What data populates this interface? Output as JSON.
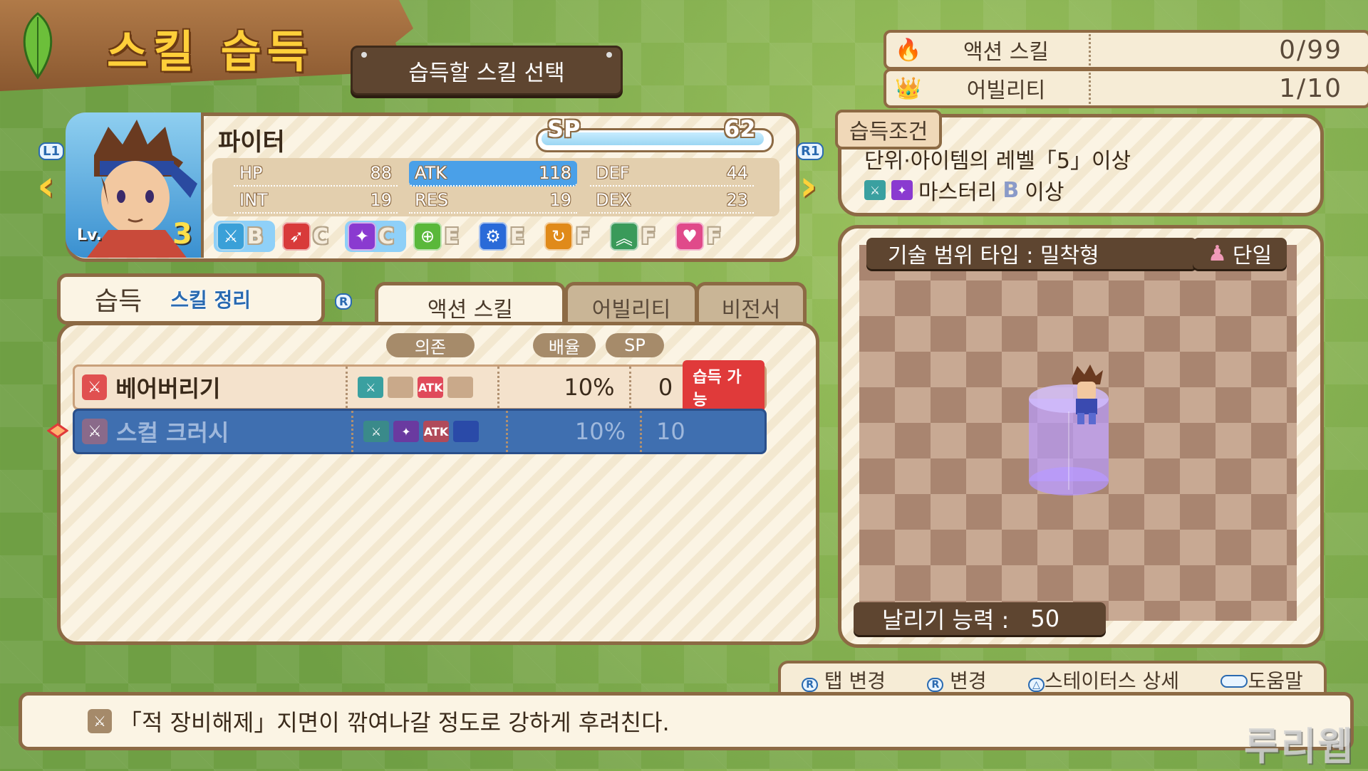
{
  "header": {
    "title": "스킬 습득",
    "subtitle": "습득할 스킬 선택"
  },
  "counters": [
    {
      "icon": "action-skill-icon",
      "label": "액션 스킬",
      "value": "0/99"
    },
    {
      "icon": "ability-icon",
      "label": "어빌리티",
      "value": "1/10"
    }
  ],
  "character": {
    "name": "파이터",
    "level_label": "Lv.",
    "level": "3",
    "sp_label": "SP",
    "sp_value": "62",
    "stats": {
      "hp": {
        "label": "HP",
        "value": "88"
      },
      "atk": {
        "label": "ATK",
        "value": "118"
      },
      "def": {
        "label": "DEF",
        "value": "44"
      },
      "int": {
        "label": "INT",
        "value": "19"
      },
      "res": {
        "label": "RES",
        "value": "19"
      },
      "dex": {
        "label": "DEX",
        "value": "23"
      }
    },
    "weapon_grades": [
      {
        "icon": "sword-icon",
        "color": "#3aa0d8",
        "grade": "B",
        "selected": true
      },
      {
        "icon": "spear-icon",
        "color": "#d83a3a",
        "grade": "C"
      },
      {
        "icon": "axe-icon",
        "color": "#8a3ad0",
        "grade": "C",
        "selected": true
      },
      {
        "icon": "bow-icon",
        "color": "#5ab83a",
        "grade": "E"
      },
      {
        "icon": "gun-icon",
        "color": "#2a6ad8",
        "grade": "E"
      },
      {
        "icon": "fist-icon",
        "color": "#e08a1a",
        "grade": "F"
      },
      {
        "icon": "staff-icon",
        "color": "#3a9a5a",
        "grade": "F"
      },
      {
        "icon": "heart-icon",
        "color": "#e04a8a",
        "grade": "F"
      }
    ],
    "nav_left": "L1",
    "nav_right": "R1"
  },
  "learn": {
    "label": "습득",
    "organize": "스킬 정리",
    "r_hint": "R"
  },
  "tabs": [
    {
      "label": "액션 스킬",
      "active": true
    },
    {
      "label": "어빌리티",
      "active": false
    },
    {
      "label": "비전서",
      "active": false
    }
  ],
  "columns": {
    "deps": "의존",
    "rate": "배율",
    "sp": "SP"
  },
  "skills": [
    {
      "name": "베어버리기",
      "rate": "10%",
      "sp": "0",
      "badge": "습득 가능",
      "deps_atk": "ATK"
    },
    {
      "name": "스컬 크러시",
      "rate": "10%",
      "sp": "10",
      "badge": "",
      "deps_atk": "ATK"
    }
  ],
  "requirements": {
    "tag": "습득조건",
    "line1": "단위·아이템의 레벨「5」이상",
    "line2_text": "마스터리",
    "line2_grade": "B",
    "line2_suffix": "이상"
  },
  "preview": {
    "range_type": "기술 범위 타입 : 밀착형",
    "target": "단일",
    "knockback_label": "날리기 능력 :",
    "knockback_value": "50"
  },
  "help": [
    {
      "key": "R",
      "label": "탭 변경"
    },
    {
      "key": "R",
      "label": "변경"
    },
    {
      "key": "△",
      "label": "스테이터스 상세"
    },
    {
      "key": "",
      "label": "도움말"
    }
  ],
  "description": "「적 장비해제」지면이 깎여나갈 정도로 강하게 후려친다.",
  "watermark": "루리웹",
  "colors": {
    "accent_blue": "#3f6fb0",
    "badge_red": "#e03a3a",
    "title_yellow": "#ffcf3a",
    "frame_brown": "#8c6a44"
  }
}
